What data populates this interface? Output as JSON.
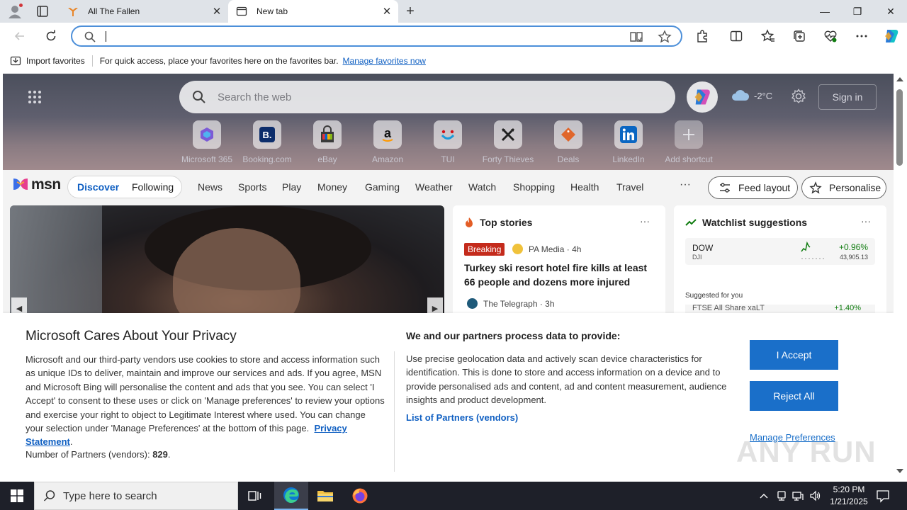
{
  "browser": {
    "tabs": [
      {
        "title": "All The Fallen",
        "close": "✕"
      },
      {
        "title": "New tab",
        "close": "✕"
      }
    ],
    "new_tab": "+",
    "window_controls": {
      "minimize": "—",
      "maximize": "❐",
      "close": "✕"
    },
    "address": {
      "value": "",
      "placeholder": ""
    },
    "favorites_bar": {
      "import_label": "Import favorites",
      "hint": "For quick access, place your favorites here on the favorites bar.",
      "manage_link": "Manage favorites now"
    }
  },
  "newtab": {
    "search_placeholder": "Search the web",
    "weather": {
      "temp": "-2°C",
      "icon": "cloud-icon"
    },
    "signin": "Sign in",
    "shortcuts": [
      {
        "label": "Microsoft 365",
        "icon": "microsoft365-icon"
      },
      {
        "label": "Booking.com",
        "icon": "booking-icon"
      },
      {
        "label": "eBay",
        "icon": "ebay-icon"
      },
      {
        "label": "Amazon",
        "icon": "amazon-icon"
      },
      {
        "label": "TUI",
        "icon": "tui-icon"
      },
      {
        "label": "Forty Thieves",
        "icon": "forty-thieves-icon"
      },
      {
        "label": "Deals",
        "icon": "deals-icon"
      },
      {
        "label": "LinkedIn",
        "icon": "linkedin-icon"
      },
      {
        "label": "Add shortcut",
        "icon": "plus-icon"
      }
    ],
    "msn": {
      "logo_text": "msn",
      "pills": [
        "Discover",
        "Following"
      ],
      "nav": [
        "News",
        "Sports",
        "Play",
        "Money",
        "Gaming",
        "Weather",
        "Watch",
        "Shopping",
        "Health",
        "Travel"
      ],
      "more": "···",
      "feed_layout": "Feed layout",
      "personalise": "Personalise"
    },
    "top_stories": {
      "title": "Top stories",
      "more": "···",
      "badge": "Breaking",
      "source1": "PA Media · 4h",
      "headline": "Turkey ski resort hotel fire kills at least 66 people and dozens more injured",
      "source2": "The Telegraph · 3h"
    },
    "watchlist": {
      "title": "Watchlist suggestions",
      "more": "···",
      "stock": {
        "name": "DOW",
        "exchange": "DJI",
        "change": "+0.96%",
        "price": "43,905.13"
      },
      "suggested": "Suggested for you",
      "stock2_name": "FTSE All Share xaLT",
      "stock2_change": "+1.40%"
    }
  },
  "privacy": {
    "title": "Microsoft Cares About Your Privacy",
    "body": "Microsoft and our third-party vendors use cookies to store and access information such as unique IDs to deliver, maintain and improve our services and ads. If you agree, MSN and Microsoft Bing will personalise the content and ads that you see. You can select 'I Accept' to consent to these uses or click on 'Manage preferences' to review your options and exercise your right to object to Legitimate Interest where used.  You can change your selection under 'Manage Preferences' at the bottom of this page.",
    "privacy_link": "Privacy Statement",
    "partners_label": "Number of Partners (vendors):",
    "partners_count": "829",
    "purpose_title": "We and our partners process data to provide:",
    "purpose_body": "Use precise geolocation data and actively scan device characteristics for identification. This is done to store and access information on a device and to provide personalised ads and content, ad and content measurement, audience insights and product development.",
    "partners_link": "List of Partners (vendors)",
    "accept": "I Accept",
    "reject": "Reject All",
    "manage": "Manage Preferences",
    "watermark": "ANY RUN"
  },
  "taskbar": {
    "search_placeholder": "Type here to search",
    "time": "5:20 PM",
    "date": "1/21/2025"
  },
  "colors": {
    "accent": "#1a6fc9",
    "link": "#0f5fc2",
    "breaking": "#c42b1c",
    "positive": "#107c10"
  }
}
